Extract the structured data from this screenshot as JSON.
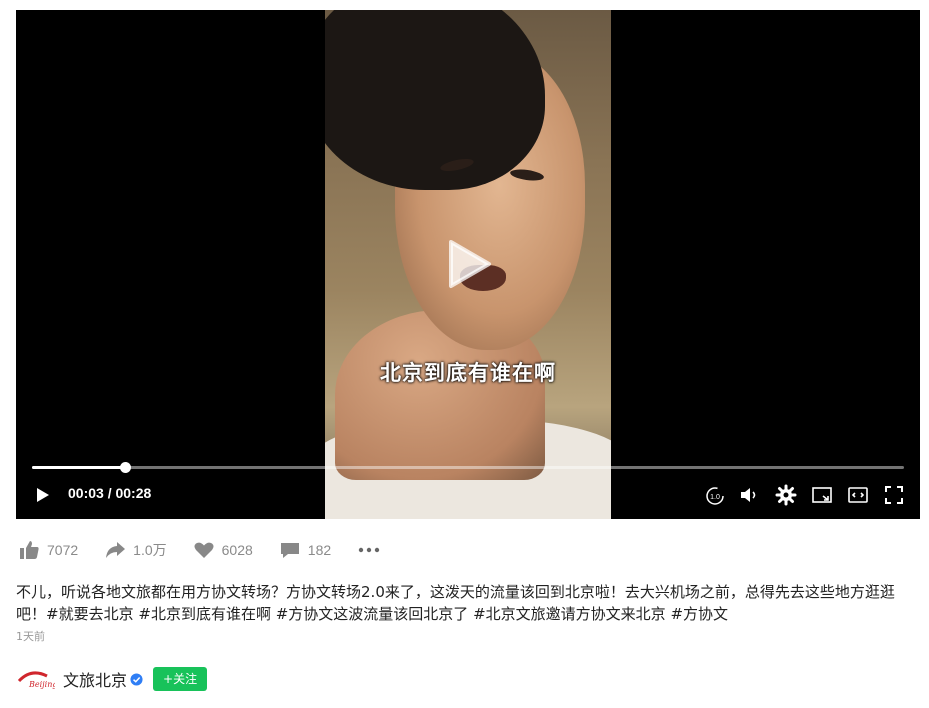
{
  "player": {
    "subtitle": "北京到底有谁在啊",
    "current_time": "00:03",
    "duration": "00:28",
    "time_separator": " / ",
    "progress_fraction": 0.107,
    "speed_label": "1.0"
  },
  "actions": {
    "likes": "7072",
    "shares": "1.0万",
    "favorites": "6028",
    "comments": "182"
  },
  "post": {
    "text": "不儿，听说各地文旅都在用方协文转场？方协文转场2.0来了，这泼天的流量该回到北京啦！去大兴机场之前，总得先去这些地方逛逛吧！",
    "hashtags": [
      "#就要去北京",
      "#北京到底有谁在啊",
      "#方协文这波流量该回北京了",
      "#北京文旅邀请方协文来北京",
      "#方协文"
    ],
    "posted_time": "1天前"
  },
  "author": {
    "name": "文旅北京",
    "follow_label": "+关注",
    "logo_text": "Beijing"
  },
  "colors": {
    "follow_button": "#18c25a",
    "verified": "#2f7ef5",
    "action_icon": "#888888"
  }
}
